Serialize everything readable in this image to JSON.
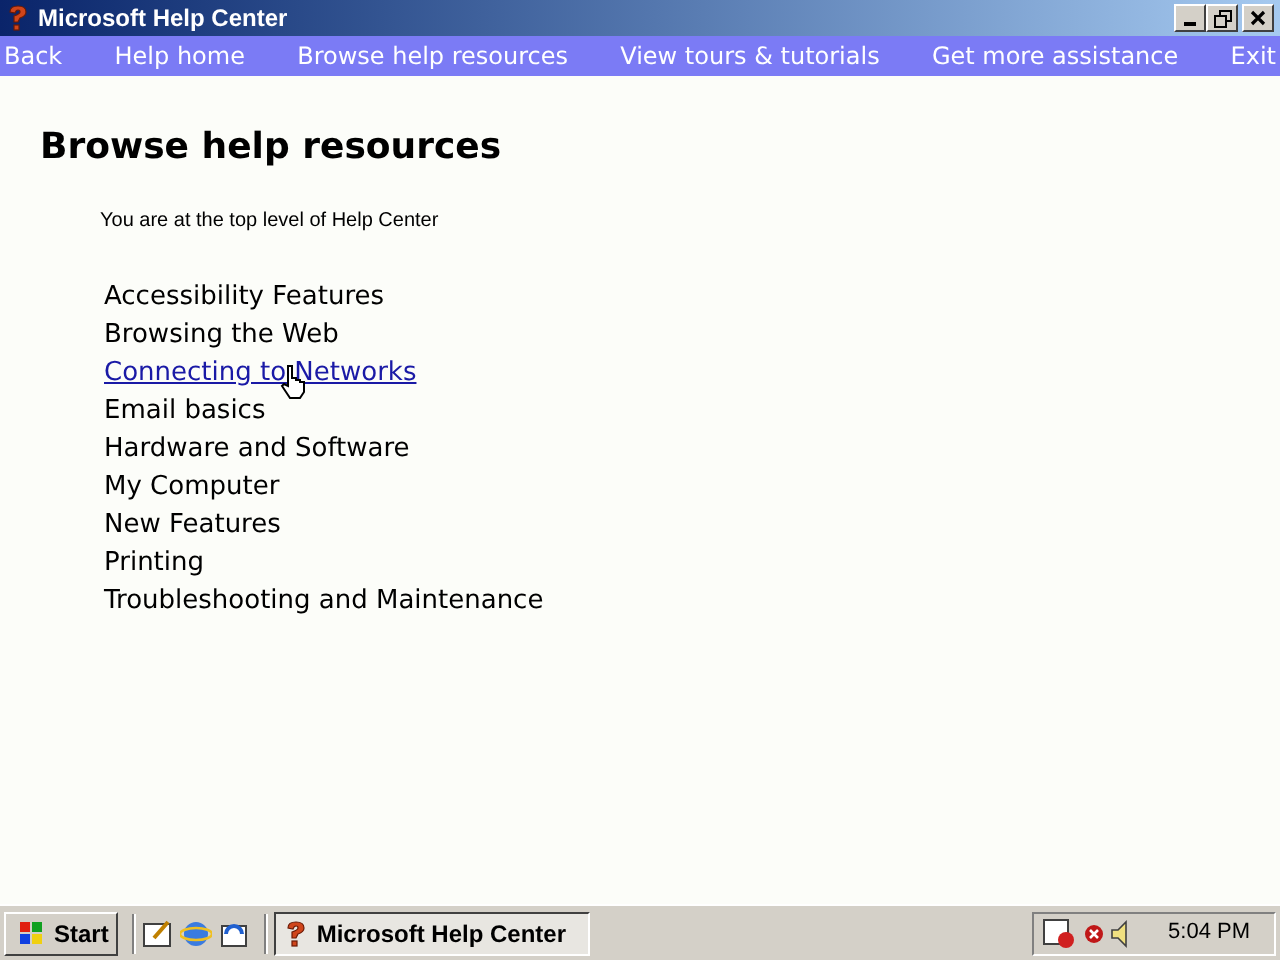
{
  "window": {
    "title": "Microsoft Help Center"
  },
  "nav": [
    {
      "label": "Back"
    },
    {
      "label": "Help home"
    },
    {
      "label": "Browse help resources"
    },
    {
      "label": "View tours & tutorials"
    },
    {
      "label": "Get more assistance"
    },
    {
      "label": "Exit"
    }
  ],
  "heading": "Browse help resources",
  "location": "You are at the top level of Help Center",
  "topics": [
    {
      "label": "Accessibility Features",
      "hovered": false
    },
    {
      "label": "Browsing the Web",
      "hovered": false
    },
    {
      "label": "Connecting to Networks",
      "hovered": true
    },
    {
      "label": "Email basics",
      "hovered": false
    },
    {
      "label": "Hardware and Software",
      "hovered": false
    },
    {
      "label": "My Computer",
      "hovered": false
    },
    {
      "label": "New Features",
      "hovered": false
    },
    {
      "label": "Printing",
      "hovered": false
    },
    {
      "label": "Troubleshooting and Maintenance",
      "hovered": false
    }
  ],
  "taskbar": {
    "start": "Start",
    "tasks": [
      {
        "label": "Microsoft Help Center",
        "selected": true
      }
    ],
    "clock": "5:04 PM"
  }
}
